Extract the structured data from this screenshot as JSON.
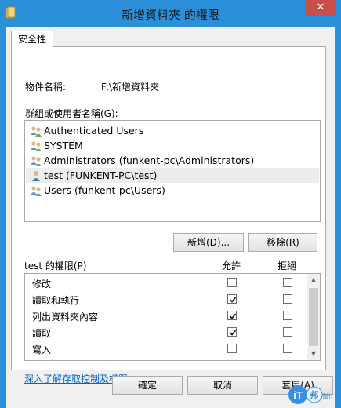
{
  "window": {
    "title": "新增資料夾 的權限",
    "close_glyph": "✕"
  },
  "tabs": [
    {
      "label": "安全性"
    }
  ],
  "object": {
    "label": "物件名稱:",
    "value": "F:\\新增資料夾"
  },
  "groups": {
    "label": "群組或使用者名稱(G):",
    "items": [
      {
        "name": "Authenticated Users",
        "icon": "group-users-icon",
        "selected": false
      },
      {
        "name": "SYSTEM",
        "icon": "group-users-icon",
        "selected": false
      },
      {
        "name": "Administrators (funkent-pc\\Administrators)",
        "icon": "group-users-icon",
        "selected": false
      },
      {
        "name": "test (FUNKENT-PC\\test)",
        "icon": "single-user-icon",
        "selected": true
      },
      {
        "name": "Users (funkent-pc\\Users)",
        "icon": "group-users-icon",
        "selected": false
      }
    ]
  },
  "buttons": {
    "add": "新增(D)...",
    "remove": "移除(R)",
    "ok": "確定",
    "cancel": "取消",
    "apply": "套用(A)"
  },
  "permissions": {
    "label": "test 的權限(P)",
    "allow_header": "允許",
    "deny_header": "拒絕",
    "rows": [
      {
        "name": "修改",
        "allow": false,
        "deny": false
      },
      {
        "name": "讀取和執行",
        "allow": true,
        "deny": false
      },
      {
        "name": "列出資料夾內容",
        "allow": true,
        "deny": false
      },
      {
        "name": "讀取",
        "allow": true,
        "deny": false
      },
      {
        "name": "寫入",
        "allow": false,
        "deny": false
      }
    ]
  },
  "advanced_link": "深入了解存取控制及權限",
  "watermark": {
    "main": "iT",
    "sub": "邦",
    "tag": "幫忙"
  },
  "colors": {
    "titlebar": "#2c8fd9",
    "close": "#c7504a",
    "link": "#0066cc"
  }
}
